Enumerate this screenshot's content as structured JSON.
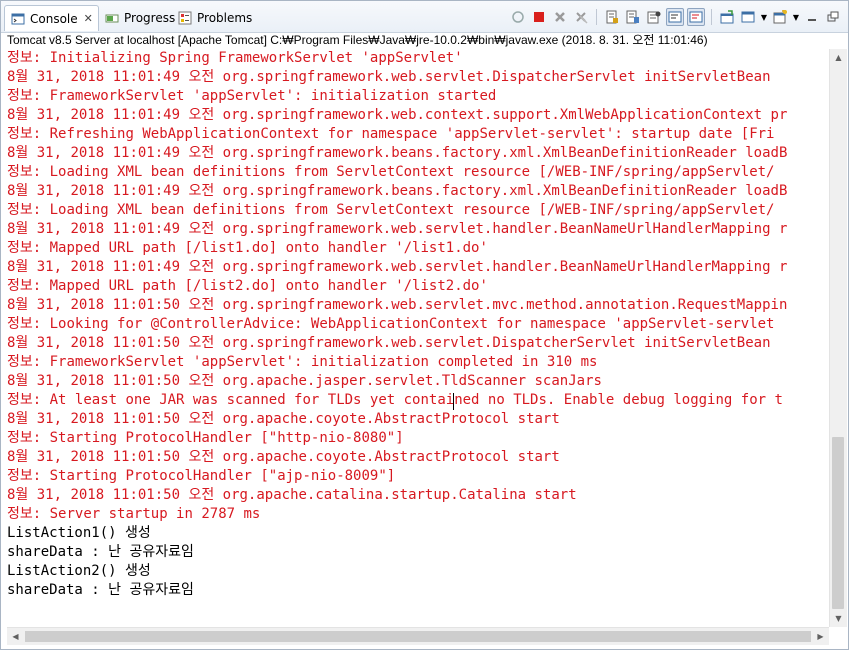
{
  "tabs": [
    {
      "label": "Console",
      "icon": "console-icon",
      "active": true
    },
    {
      "label": "Progress",
      "icon": "progress-icon",
      "active": false
    },
    {
      "label": "Problems",
      "icon": "problems-icon",
      "active": false
    }
  ],
  "tab_close": "✕",
  "process_title": "Tomcat v8.5 Server at localhost [Apache Tomcat] C:₩Program Files₩Java₩jre-10.0.2₩bin₩javaw.exe (2018. 8. 31. 오전 11:01:46)",
  "toolbar_icons": [
    "clear-console-icon",
    "terminate-icon",
    "remove-launch-icon",
    "remove-all-terminated-icon",
    "scroll-lock-icon",
    "word-wrap-icon",
    "show-on-stdout-icon",
    "show-on-stderr-icon",
    "pin-console-icon",
    "display-selected-console-icon",
    "open-console-icon",
    "minimize-icon",
    "maximize-icon"
  ],
  "colors": {
    "stderr": "#d71920",
    "stdout": "#000000",
    "accent": "#3c7fb1"
  },
  "console_lines": [
    {
      "text": "정보: Initializing Spring FrameworkServlet 'appServlet'",
      "stream": "err"
    },
    {
      "text": "8월 31, 2018 11:01:49 오전 org.springframework.web.servlet.DispatcherServlet initServletBean",
      "stream": "err"
    },
    {
      "text": "정보: FrameworkServlet 'appServlet': initialization started",
      "stream": "err"
    },
    {
      "text": "8월 31, 2018 11:01:49 오전 org.springframework.web.context.support.XmlWebApplicationContext pr",
      "stream": "err"
    },
    {
      "text": "정보: Refreshing WebApplicationContext for namespace 'appServlet-servlet': startup date [Fri",
      "stream": "err"
    },
    {
      "text": "8월 31, 2018 11:01:49 오전 org.springframework.beans.factory.xml.XmlBeanDefinitionReader loadB",
      "stream": "err"
    },
    {
      "text": "정보: Loading XML bean definitions from ServletContext resource [/WEB-INF/spring/appServlet/",
      "stream": "err"
    },
    {
      "text": "8월 31, 2018 11:01:49 오전 org.springframework.beans.factory.xml.XmlBeanDefinitionReader loadB",
      "stream": "err"
    },
    {
      "text": "정보: Loading XML bean definitions from ServletContext resource [/WEB-INF/spring/appServlet/",
      "stream": "err"
    },
    {
      "text": "8월 31, 2018 11:01:49 오전 org.springframework.web.servlet.handler.BeanNameUrlHandlerMapping r",
      "stream": "err"
    },
    {
      "text": "정보: Mapped URL path [/list1.do] onto handler '/list1.do'",
      "stream": "err"
    },
    {
      "text": "8월 31, 2018 11:01:49 오전 org.springframework.web.servlet.handler.BeanNameUrlHandlerMapping r",
      "stream": "err"
    },
    {
      "text": "정보: Mapped URL path [/list2.do] onto handler '/list2.do'",
      "stream": "err"
    },
    {
      "text": "8월 31, 2018 11:01:50 오전 org.springframework.web.servlet.mvc.method.annotation.RequestMappin",
      "stream": "err"
    },
    {
      "text": "정보: Looking for @ControllerAdvice: WebApplicationContext for namespace 'appServlet-servlet",
      "stream": "err"
    },
    {
      "text": "8월 31, 2018 11:01:50 오전 org.springframework.web.servlet.DispatcherServlet initServletBean",
      "stream": "err"
    },
    {
      "text": "정보: FrameworkServlet 'appServlet': initialization completed in 310 ms",
      "stream": "err"
    },
    {
      "text": "8월 31, 2018 11:01:50 오전 org.apache.jasper.servlet.TldScanner scanJars",
      "stream": "err"
    },
    {
      "text": "정보: At least one JAR was scanned for TLDs yet contained no TLDs. Enable debug logging for t",
      "stream": "err"
    },
    {
      "text": "8월 31, 2018 11:01:50 오전 org.apache.coyote.AbstractProtocol start",
      "stream": "err"
    },
    {
      "text": "정보: Starting ProtocolHandler [\"http-nio-8080\"]",
      "stream": "err"
    },
    {
      "text": "8월 31, 2018 11:01:50 오전 org.apache.coyote.AbstractProtocol start",
      "stream": "err"
    },
    {
      "text": "정보: Starting ProtocolHandler [\"ajp-nio-8009\"]",
      "stream": "err"
    },
    {
      "text": "8월 31, 2018 11:01:50 오전 org.apache.catalina.startup.Catalina start",
      "stream": "err"
    },
    {
      "text": "정보: Server startup in 2787 ms",
      "stream": "err"
    },
    {
      "text": "ListAction1() 생성",
      "stream": "out"
    },
    {
      "text": "shareData : 난 공유자료임",
      "stream": "out"
    },
    {
      "text": "ListAction2() 생성",
      "stream": "out"
    },
    {
      "text": "shareData : 난 공유자료임",
      "stream": "out"
    }
  ]
}
